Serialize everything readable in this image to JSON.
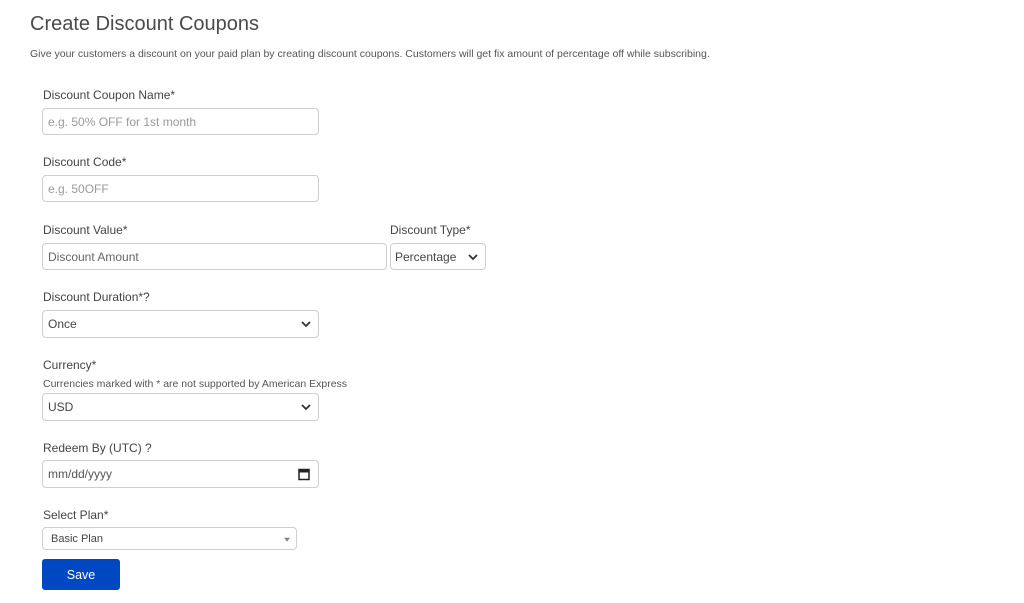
{
  "page": {
    "title": "Create Discount Coupons",
    "subtitle": "Give your customers a discount on your paid plan by creating discount coupons. Customers will get fix amount of percentage off while subscribing."
  },
  "form": {
    "coupon_name": {
      "label": "Discount Coupon Name*",
      "placeholder": "e.g. 50% OFF for 1st month",
      "value": ""
    },
    "coupon_code": {
      "label": "Discount Code*",
      "placeholder": "e.g. 50OFF",
      "value": ""
    },
    "discount_value": {
      "label": "Discount Value*",
      "placeholder": "Discount Amount",
      "value": ""
    },
    "discount_type": {
      "label": "Discount Type*",
      "selected": "Percentage"
    },
    "discount_duration": {
      "label": "Discount Duration*?",
      "selected": "Once"
    },
    "currency": {
      "label": "Currency*",
      "help": "Currencies marked with * are not supported by American Express",
      "selected": "USD"
    },
    "redeem_by": {
      "label": "Redeem By (UTC) ?",
      "placeholder": "mm/dd/yyyy",
      "icon": "calendar-icon"
    },
    "plan": {
      "label": "Select Plan*",
      "selected": "Basic Plan"
    },
    "save_label": "Save"
  },
  "colors": {
    "primary_button": "#0047c4",
    "border": "#cfcfcf"
  }
}
